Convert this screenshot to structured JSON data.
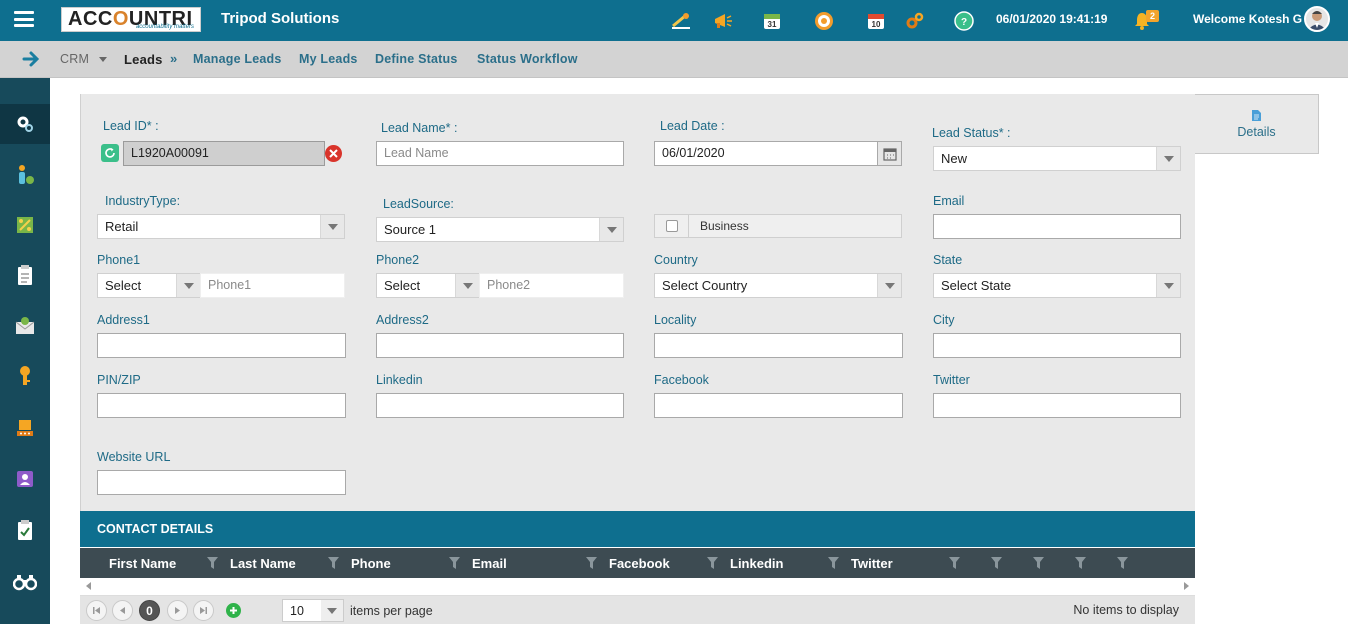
{
  "topbar": {
    "logo_text": "ACCOUNTRI",
    "logo_tagline": "accountability matters",
    "company": "Tripod Solutions",
    "datetime": "06/01/2020 19:41:19",
    "notification_count": "2",
    "welcome": "Welcome Kotesh G",
    "calendar_day": "31",
    "calendar_day2": "10",
    "icons": [
      "graduation-icon",
      "megaphone-icon",
      "calendar-icon",
      "target-icon",
      "schedule-icon",
      "settings-icon",
      "help-icon",
      "bell-icon"
    ]
  },
  "breadcrumb": {
    "crm": "CRM",
    "leads": "Leads",
    "sep": "»",
    "items": [
      "Manage Leads",
      "My Leads",
      "Define Status",
      "Status Workflow"
    ]
  },
  "details_tab": "Details",
  "form": {
    "lead_id_label": "Lead ID* :",
    "lead_id_value": "L1920A00091",
    "lead_name_label": "Lead Name* :",
    "lead_name_placeholder": "Lead Name",
    "lead_date_label": "Lead Date :",
    "lead_date_value": "06/01/2020",
    "lead_status_label": "Lead Status* :",
    "lead_status_value": "New",
    "industry_label": "IndustryType:",
    "industry_value": "Retail",
    "source_label": "LeadSource:",
    "source_value": "Source 1",
    "business_label": "Business",
    "email_label": "Email",
    "phone1_label": "Phone1",
    "phone1_code": "Select",
    "phone1_placeholder": "Phone1",
    "phone2_label": "Phone2",
    "phone2_code": "Select",
    "phone2_placeholder": "Phone2",
    "country_label": "Country",
    "country_value": "Select Country",
    "state_label": "State",
    "state_value": "Select State",
    "address1_label": "Address1",
    "address2_label": "Address2",
    "locality_label": "Locality",
    "city_label": "City",
    "pin_label": "PIN/ZIP",
    "linkedin_label": "Linkedin",
    "facebook_label": "Facebook",
    "twitter_label": "Twitter",
    "website_label": "Website URL"
  },
  "contacts": {
    "title": "CONTACT DETAILS",
    "columns": [
      "First Name",
      "Last Name",
      "Phone",
      "Email",
      "Facebook",
      "Linkedin",
      "Twitter"
    ],
    "page_current": "0",
    "page_size": "10",
    "items_per_page": "items per page",
    "no_items": "No items to display"
  },
  "colors": {
    "topbar": "#0e6f8f",
    "sidebar": "#174a5b",
    "accent_label": "#1e6a86",
    "grid_header": "#3d4b52"
  }
}
